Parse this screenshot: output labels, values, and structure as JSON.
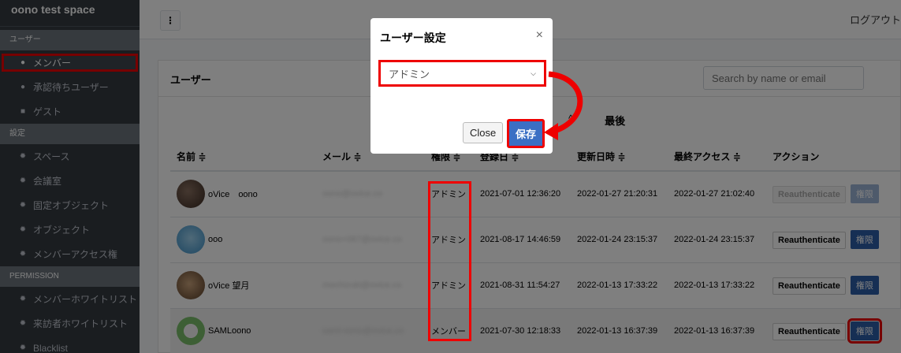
{
  "sidebar": {
    "brand": "oono test space",
    "sections": [
      {
        "title": "ユーザー",
        "items": [
          {
            "label": "メンバー",
            "icon": "user-icon",
            "active": true
          },
          {
            "label": "承認待ちユーザー",
            "icon": "user-plus-icon"
          },
          {
            "label": "ゲスト",
            "icon": "guest-icon"
          }
        ]
      },
      {
        "title": "設定",
        "items": [
          {
            "label": "スペース",
            "icon": "gear-icon"
          },
          {
            "label": "会議室",
            "icon": "gear-icon"
          },
          {
            "label": "固定オブジェクト",
            "icon": "gear-icon"
          },
          {
            "label": "オブジェクト",
            "icon": "gear-icon"
          },
          {
            "label": "メンバーアクセス権",
            "icon": "gear-icon"
          }
        ]
      },
      {
        "title": "PERMISSION",
        "items": [
          {
            "label": "メンバーホワイトリスト",
            "icon": "gear-icon"
          },
          {
            "label": "来訪者ホワイトリスト",
            "icon": "gear-icon"
          },
          {
            "label": "Blacklist",
            "icon": "gear-icon"
          }
        ]
      }
    ]
  },
  "topbar": {
    "menu_icon": "⋮",
    "logout": "ログアウト"
  },
  "card": {
    "title": "ユーザー",
    "search_placeholder": "Search by name or email",
    "pager": {
      "prev_icon": "^",
      "last": "最後"
    },
    "columns": [
      "名前 ≑",
      "メール ≑",
      "権限 ≑",
      "登録日 ≑",
      "更新日時 ≑",
      "最終アクセス ≑",
      "アクション"
    ],
    "rows": [
      {
        "name": "oVice　oono",
        "email": "oono@ovice.co",
        "role": "アドミン",
        "registered": "2021-07-01 12:36:20",
        "updated": "2022-01-27 21:20:31",
        "last_access": "2022-01-27 21:02:40",
        "reauth": "Reauthenticate",
        "perm": "権限"
      },
      {
        "name": "ooo",
        "email": "oono+067@ovice.co",
        "role": "アドミン",
        "registered": "2021-08-17 14:46:59",
        "updated": "2022-01-24 23:15:37",
        "last_access": "2022-01-24 23:15:37",
        "reauth": "Reauthenticate",
        "perm": "権限"
      },
      {
        "name": "oVice 望月",
        "email": "mochizuki@ovice.co",
        "role": "アドミン",
        "registered": "2021-08-31 11:54:27",
        "updated": "2022-01-13 17:33:22",
        "last_access": "2022-01-13 17:33:22",
        "reauth": "Reauthenticate",
        "perm": "権限"
      },
      {
        "name": "SAMLoono",
        "email": "saml-oono@ovice.co",
        "role": "メンバー",
        "registered": "2021-07-30 12:18:33",
        "updated": "2022-01-13 16:37:39",
        "last_access": "2022-01-13 16:37:39",
        "reauth": "Reauthenticate",
        "perm": "権限"
      }
    ]
  },
  "modal": {
    "title": "ユーザー設定",
    "close_icon": "×",
    "selected_role": "アドミン",
    "close_label": "Close",
    "save_label": "保存"
  },
  "colors": {
    "sidebar_bg": "#343a40",
    "primary": "#2c5ea8",
    "annotation": "#e00000"
  }
}
